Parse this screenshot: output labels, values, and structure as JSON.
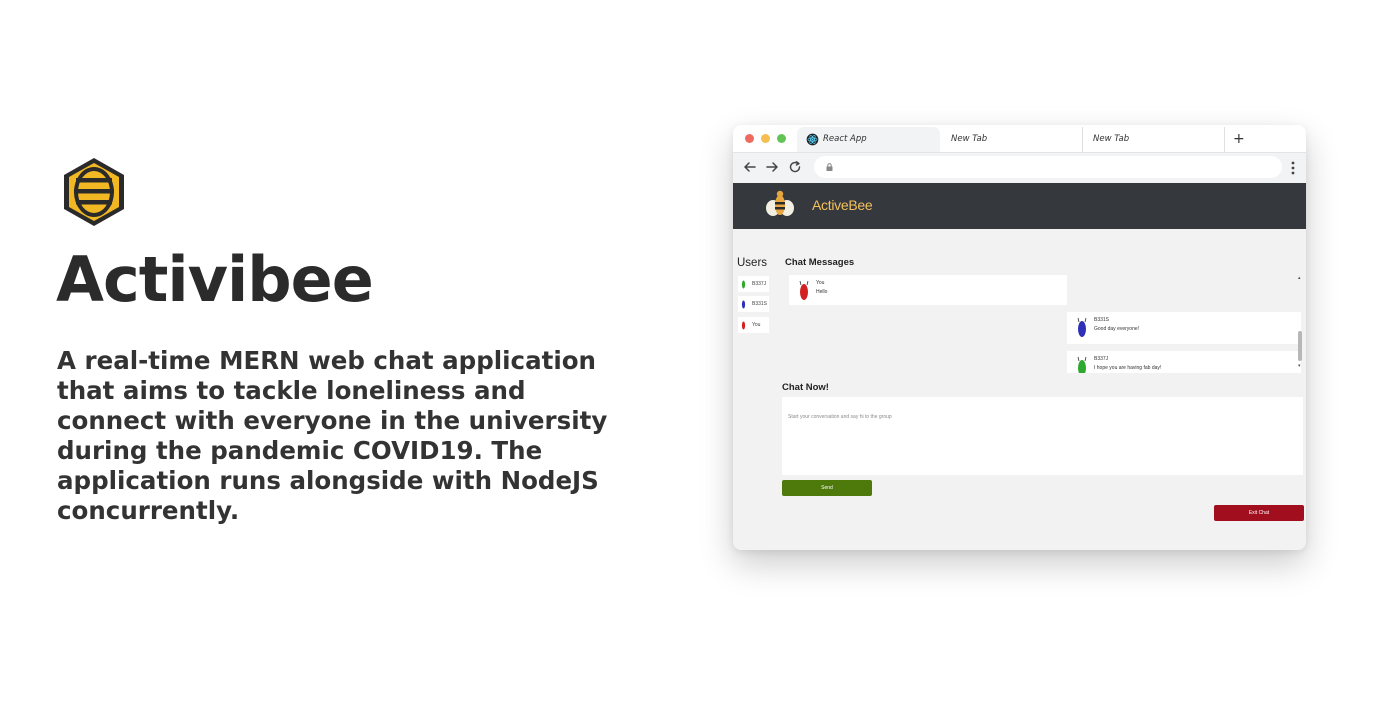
{
  "hero": {
    "logo_icon": "bee-hexagon-icon",
    "title": "Activibee",
    "description": "A real-time MERN web chat application that aims to tackle loneliness and connect with everyone in the university during the pandemic COVID19. The application runs alongside with NodeJS concurrently."
  },
  "browser": {
    "tabs": [
      {
        "label": "React App",
        "icon": "react-icon",
        "active": true
      },
      {
        "label": "New Tab",
        "active": false
      },
      {
        "label": "New Tab",
        "active": false
      }
    ],
    "new_tab_label": "+",
    "address": ""
  },
  "app": {
    "brand": "ActiveBee",
    "users_title": "Users",
    "users": [
      {
        "name": "B337J",
        "color": "#2ea82e"
      },
      {
        "name": "B331S",
        "color": "#2f2fb8"
      },
      {
        "name": "You",
        "color": "#d22121"
      }
    ],
    "chat_title": "Chat Messages",
    "messages": [
      {
        "sender": "You",
        "text": "Hello",
        "color": "#d22121",
        "side": "left"
      },
      {
        "sender": "B331S",
        "text": "Good day everyone!",
        "color": "#2f2fb8",
        "side": "right"
      },
      {
        "sender": "B337J",
        "text": "I hope you are having fab day!",
        "color": "#2ea82e",
        "side": "right"
      }
    ],
    "chat_now_title": "Chat Now!",
    "input_placeholder": "Start your conversation and say hi to the group",
    "send_label": "Send",
    "exit_label": "Exit Chat"
  },
  "colors": {
    "header_bg": "#35383d",
    "brand": "#f2c15b",
    "send_btn": "#4e7a0c",
    "exit_btn": "#a10e1e",
    "logo": "#f2b824"
  }
}
